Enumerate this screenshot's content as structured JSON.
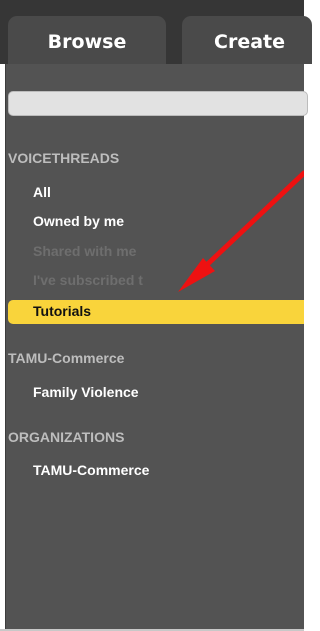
{
  "tabs": {
    "browse": "Browse",
    "create": "Create"
  },
  "search": {
    "placeholder": ""
  },
  "sidebar": {
    "voicethreads_heading": "VOICETHREADS",
    "items": [
      {
        "label": "All",
        "state": "normal"
      },
      {
        "label": "Owned by me",
        "state": "normal"
      },
      {
        "label": "Shared with me",
        "state": "disabled"
      },
      {
        "label": "I've subscribed t",
        "state": "disabled"
      },
      {
        "label": "Tutorials",
        "state": "selected"
      }
    ],
    "group_heading": "TAMU-Commerce",
    "group_items": [
      {
        "label": "Family Violence",
        "state": "normal"
      }
    ],
    "organizations_heading": "ORGANIZATIONS",
    "organization_items": [
      {
        "label": "TAMU-Commerce",
        "state": "normal"
      }
    ]
  },
  "colors": {
    "selected_highlight": "#f9d43b",
    "annotation_arrow": "#ee1111",
    "panel_background": "#535353",
    "topbar_background": "#363636"
  },
  "icons": {
    "annotation": "red-arrow-icon"
  }
}
